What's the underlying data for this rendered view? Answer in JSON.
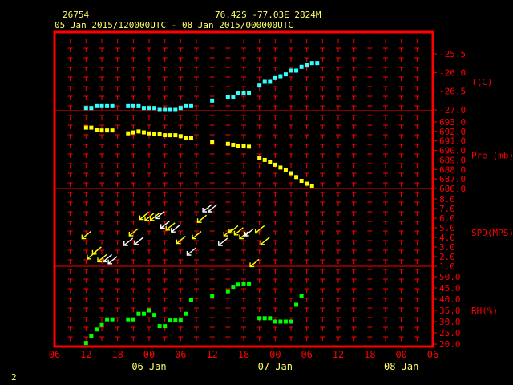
{
  "header": {
    "station_id": "26754",
    "location": "76.42S   -77.03E   2824M",
    "time_range": "05 Jan 2015/120000UTC - 08 Jan 2015/000000UTC"
  },
  "footer": {
    "page_number": "2"
  },
  "colors": {
    "frame": "#ff0000",
    "text_header": "#ffff66",
    "axis_text": "#ff0000",
    "temp": "#33ffff",
    "pressure": "#ffff00",
    "wind_yellow": "#ffff00",
    "wind_white": "#ffffff",
    "rh": "#00ff00"
  },
  "chart_data": {
    "type": "scatter",
    "x_axis": {
      "unit": "hours from 05 Jan 2015 00 UTC",
      "range": [
        6,
        78
      ],
      "ticks": [
        6,
        12,
        18,
        24,
        30,
        36,
        42,
        48,
        54,
        60,
        66,
        72,
        78
      ],
      "tick_labels": [
        "06",
        "12",
        "18",
        "00",
        "06",
        "12",
        "18",
        "00",
        "06",
        "12",
        "18",
        "00",
        "06"
      ],
      "day_labels": [
        {
          "x": 24,
          "label": "06 Jan"
        },
        {
          "x": 48,
          "label": "07 Jan"
        },
        {
          "x": 72,
          "label": "08 Jan"
        }
      ]
    },
    "panels": [
      {
        "id": "temperature",
        "label": "T(C)",
        "ylim": [
          -27.0,
          -25.5
        ],
        "tick_values": [
          -27.0,
          -26.5,
          -26.0,
          -25.5
        ],
        "tick_labels": [
          "-27.0",
          "-26.5",
          "-26.0",
          "-25.5"
        ],
        "points": [
          [
            12,
            -26.95
          ],
          [
            13,
            -26.95
          ],
          [
            14,
            -26.9
          ],
          [
            15,
            -26.9
          ],
          [
            16,
            -26.9
          ],
          [
            17,
            -26.9
          ],
          [
            20,
            -26.9
          ],
          [
            21,
            -26.9
          ],
          [
            22,
            -26.9
          ],
          [
            23,
            -26.95
          ],
          [
            24,
            -26.95
          ],
          [
            25,
            -26.95
          ],
          [
            26,
            -27.0
          ],
          [
            27,
            -27.0
          ],
          [
            28,
            -27.0
          ],
          [
            29,
            -27.0
          ],
          [
            30,
            -26.95
          ],
          [
            31,
            -26.9
          ],
          [
            32,
            -26.9
          ],
          [
            36,
            -26.75
          ],
          [
            39,
            -26.65
          ],
          [
            40,
            -26.65
          ],
          [
            41,
            -26.55
          ],
          [
            42,
            -26.55
          ],
          [
            43,
            -26.55
          ],
          [
            45,
            -26.35
          ],
          [
            46,
            -26.25
          ],
          [
            47,
            -26.25
          ],
          [
            48,
            -26.15
          ],
          [
            49,
            -26.1
          ],
          [
            50,
            -26.05
          ],
          [
            51,
            -25.95
          ],
          [
            52,
            -25.95
          ],
          [
            53,
            -25.85
          ],
          [
            54,
            -25.8
          ],
          [
            55,
            -25.75
          ],
          [
            56,
            -25.75
          ]
        ]
      },
      {
        "id": "pressure",
        "label": "Pre (mb)",
        "ylim": [
          686.0,
          693.0
        ],
        "tick_values": [
          686,
          687,
          688,
          689,
          690,
          691,
          692,
          693
        ],
        "tick_labels": [
          "686.0",
          "687.0",
          "688.0",
          "689.0",
          "690.0",
          "691.0",
          "692.0",
          "693.0"
        ],
        "points": [
          [
            12,
            692.4
          ],
          [
            13,
            692.4
          ],
          [
            14,
            692.2
          ],
          [
            15,
            692.1
          ],
          [
            16,
            692.1
          ],
          [
            17,
            692.1
          ],
          [
            20,
            691.8
          ],
          [
            21,
            691.9
          ],
          [
            22,
            692.0
          ],
          [
            23,
            691.9
          ],
          [
            24,
            691.8
          ],
          [
            25,
            691.7
          ],
          [
            26,
            691.7
          ],
          [
            27,
            691.6
          ],
          [
            28,
            691.6
          ],
          [
            29,
            691.6
          ],
          [
            30,
            691.5
          ],
          [
            31,
            691.3
          ],
          [
            32,
            691.3
          ],
          [
            36,
            690.9
          ],
          [
            39,
            690.7
          ],
          [
            40,
            690.6
          ],
          [
            41,
            690.5
          ],
          [
            42,
            690.5
          ],
          [
            43,
            690.4
          ],
          [
            45,
            689.2
          ],
          [
            46,
            689.0
          ],
          [
            47,
            688.8
          ],
          [
            48,
            688.5
          ],
          [
            49,
            688.2
          ],
          [
            50,
            687.9
          ],
          [
            51,
            687.6
          ],
          [
            52,
            687.2
          ],
          [
            53,
            686.8
          ],
          [
            54,
            686.5
          ],
          [
            55,
            686.3
          ]
        ]
      },
      {
        "id": "wind_speed",
        "label": "SPD(MPS)",
        "ylim": [
          1.0,
          8.0
        ],
        "tick_values": [
          1,
          2,
          3,
          4,
          5,
          6,
          7,
          8
        ],
        "tick_labels": [
          "1.0",
          "2.0",
          "3.0",
          "4.0",
          "5.0",
          "6.0",
          "7.0",
          "8.0"
        ],
        "wind_note": "wind arrows plotted at speed, pointing in flow direction",
        "points": [
          {
            "x": 12,
            "speed": 4.2,
            "color": "yellow"
          },
          {
            "x": 13,
            "speed": 2.1,
            "color": "yellow"
          },
          {
            "x": 14,
            "speed": 2.6,
            "color": "yellow"
          },
          {
            "x": 15,
            "speed": 1.8,
            "color": "yellow"
          },
          {
            "x": 16,
            "speed": 1.8,
            "color": "white"
          },
          {
            "x": 17,
            "speed": 1.6,
            "color": "white"
          },
          {
            "x": 20,
            "speed": 3.5,
            "color": "white"
          },
          {
            "x": 21,
            "speed": 4.5,
            "color": "yellow"
          },
          {
            "x": 22,
            "speed": 3.6,
            "color": "white"
          },
          {
            "x": 23,
            "speed": 6.2,
            "color": "yellow"
          },
          {
            "x": 24,
            "speed": 6.1,
            "color": "yellow"
          },
          {
            "x": 25,
            "speed": 6.1,
            "color": "yellow"
          },
          {
            "x": 26,
            "speed": 6.3,
            "color": "white"
          },
          {
            "x": 27,
            "speed": 5.3,
            "color": "white"
          },
          {
            "x": 28,
            "speed": 5.1,
            "color": "yellow"
          },
          {
            "x": 29,
            "speed": 4.9,
            "color": "white"
          },
          {
            "x": 30,
            "speed": 3.7,
            "color": "yellow"
          },
          {
            "x": 32,
            "speed": 2.5,
            "color": "white"
          },
          {
            "x": 33,
            "speed": 4.2,
            "color": "yellow"
          },
          {
            "x": 34,
            "speed": 5.9,
            "color": "yellow"
          },
          {
            "x": 35,
            "speed": 7.0,
            "color": "white"
          },
          {
            "x": 36,
            "speed": 7.0,
            "color": "white"
          },
          {
            "x": 38,
            "speed": 3.5,
            "color": "white"
          },
          {
            "x": 39,
            "speed": 4.5,
            "color": "yellow"
          },
          {
            "x": 40,
            "speed": 4.8,
            "color": "yellow"
          },
          {
            "x": 41,
            "speed": 4.6,
            "color": "yellow"
          },
          {
            "x": 42,
            "speed": 4.2,
            "color": "yellow"
          },
          {
            "x": 43,
            "speed": 4.5,
            "color": "white"
          },
          {
            "x": 44,
            "speed": 1.3,
            "color": "yellow"
          },
          {
            "x": 45,
            "speed": 4.8,
            "color": "yellow"
          },
          {
            "x": 46,
            "speed": 3.6,
            "color": "yellow"
          }
        ]
      },
      {
        "id": "rh",
        "label": "RH(%)",
        "ylim": [
          20.0,
          50.0
        ],
        "tick_values": [
          20,
          25,
          30,
          35,
          40,
          45,
          50
        ],
        "tick_labels": [
          "20.0",
          "25.0",
          "30.0",
          "35.0",
          "40.0",
          "45.0",
          "50.0"
        ],
        "points": [
          [
            12,
            20.5
          ],
          [
            13,
            23.5
          ],
          [
            14,
            26.5
          ],
          [
            15,
            28.5
          ],
          [
            16,
            31.0
          ],
          [
            17,
            31.0
          ],
          [
            20,
            31.0
          ],
          [
            21,
            31.0
          ],
          [
            22,
            33.5
          ],
          [
            23,
            33.5
          ],
          [
            24,
            35.0
          ],
          [
            25,
            33.0
          ],
          [
            26,
            28.0
          ],
          [
            27,
            28.0
          ],
          [
            28,
            30.5
          ],
          [
            29,
            30.5
          ],
          [
            30,
            30.5
          ],
          [
            31,
            33.5
          ],
          [
            32,
            39.5
          ],
          [
            36,
            41.5
          ],
          [
            39,
            43.5
          ],
          [
            40,
            45.5
          ],
          [
            41,
            46.5
          ],
          [
            42,
            47.0
          ],
          [
            43,
            47.0
          ],
          [
            45,
            31.5
          ],
          [
            46,
            31.5
          ],
          [
            47,
            31.5
          ],
          [
            48,
            30.0
          ],
          [
            49,
            30.0
          ],
          [
            50,
            30.0
          ],
          [
            51,
            30.0
          ],
          [
            52,
            37.5
          ],
          [
            53,
            41.5
          ]
        ]
      }
    ],
    "grid": true,
    "legend": "right"
  }
}
